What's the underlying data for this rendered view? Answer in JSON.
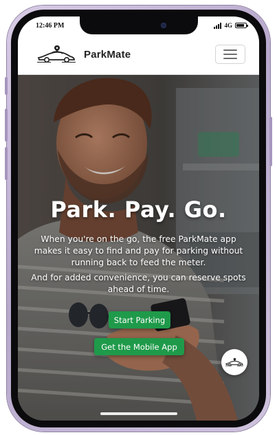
{
  "status_bar": {
    "time": "12:46 PM",
    "network": "4G"
  },
  "navbar": {
    "brand": "ParkMate"
  },
  "hero": {
    "title": "Park. Pay. Go.",
    "paragraph1": "When you're on the go, the free ParkMate app makes it easy to find and pay for parking without running back to feed the meter.",
    "paragraph2": "And for added convenience, you can reserve spots ahead of time.",
    "start_button": "Start Parking",
    "app_button": "Get the Mobile App"
  },
  "icons": {
    "logo": "car-logo-icon",
    "menu": "hamburger-menu-icon",
    "fab": "car-logo-icon",
    "signal": "signal-bars-icon",
    "battery": "battery-icon"
  },
  "colors": {
    "accent_green": "#1f9a4a",
    "navbar_bg": "#ffffff",
    "phone_frame": "#b7a8cc"
  }
}
